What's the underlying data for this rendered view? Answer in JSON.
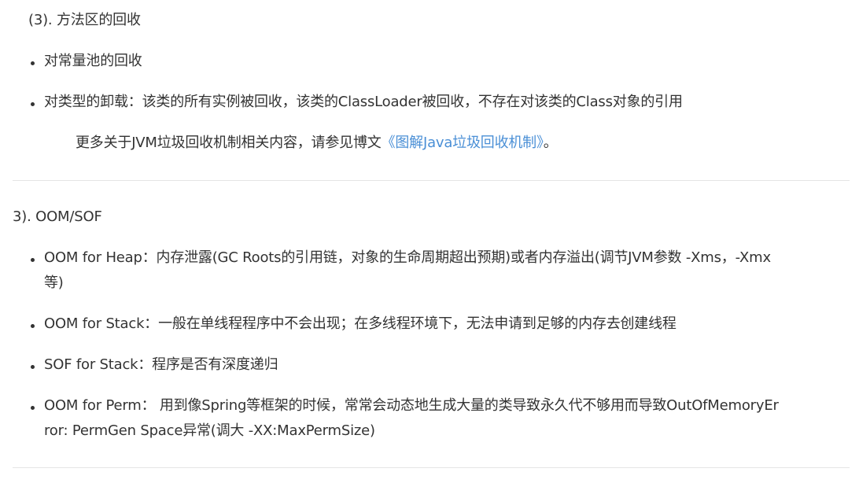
{
  "section_a": {
    "heading": "(3). 方法区的回收",
    "items": [
      "对常量池的回收",
      "对类型的卸载：该类的所有实例被回收，该类的ClassLoader被回收，不存在对该类的Class对象的引用"
    ],
    "note_prefix": "更多关于JVM垃圾回收机制相关内容，请参见博文",
    "note_link": "《图解Java垃圾回收机制》",
    "note_suffix": "。"
  },
  "section_b": {
    "heading": "3). OOM/SOF",
    "items": [
      {
        "line1": "OOM for Heap：内存泄露(GC Roots的引用链，对象的生命周期超出预期)或者内存溢出(调节JVM参数 -Xms，-Xmx",
        "line2": "等)"
      },
      {
        "line1": "OOM for Stack：一般在单线程程序中不会出现；在多线程环境下，无法申请到足够的内存去创建线程"
      },
      {
        "line1": "SOF for Stack：程序是否有深度递归"
      },
      {
        "line1": "OOM for Perm： 用到像Spring等框架的时候，常常会动态地生成大量的类导致永久代不够用而导致OutOfMemoryEr",
        "line2": "ror: PermGen Space异常(调大 -XX:MaxPermSize)"
      }
    ]
  }
}
